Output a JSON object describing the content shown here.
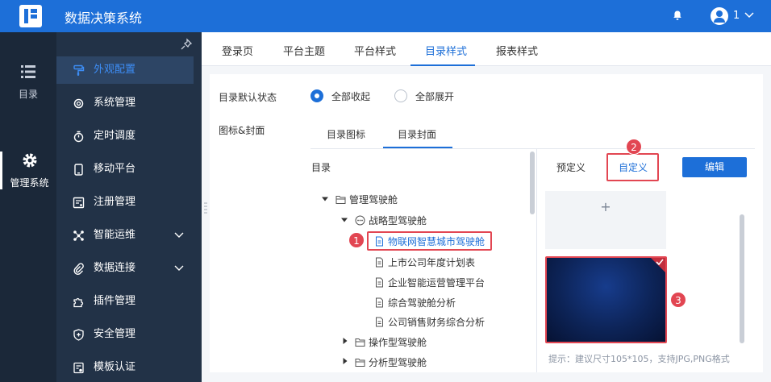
{
  "header": {
    "title": "数据决策系统",
    "user_name": "1"
  },
  "rail": {
    "items": [
      {
        "label": "目录",
        "icon": "list-icon"
      },
      {
        "label": "管理系统",
        "icon": "gear-icon"
      }
    ]
  },
  "sidebar": {
    "items": [
      {
        "label": "外观配置",
        "icon": "brush-icon",
        "active": true
      },
      {
        "label": "系统管理",
        "icon": "gear-icon"
      },
      {
        "label": "定时调度",
        "icon": "timer-icon"
      },
      {
        "label": "移动平台",
        "icon": "mobile-icon"
      },
      {
        "label": "注册管理",
        "icon": "register-icon"
      },
      {
        "label": "智能运维",
        "icon": "ops-icon",
        "expandable": true
      },
      {
        "label": "数据连接",
        "icon": "link-icon",
        "expandable": true
      },
      {
        "label": "插件管理",
        "icon": "puzzle-icon"
      },
      {
        "label": "安全管理",
        "icon": "shield-icon"
      },
      {
        "label": "模板认证",
        "icon": "certificate-icon"
      }
    ]
  },
  "tabs": [
    "登录页",
    "平台主题",
    "平台样式",
    "目录样式",
    "报表样式"
  ],
  "active_tab": "目录样式",
  "settings": {
    "default_state_label": "目录默认状态",
    "option_collapse": "全部收起",
    "option_expand": "全部展开",
    "icon_cover_label": "图标&封面"
  },
  "subtabs": [
    "目录图标",
    "目录封面"
  ],
  "tree": {
    "header": "目录",
    "nodes": [
      {
        "label": "管理驾驶舱",
        "type": "folder",
        "level": 0
      },
      {
        "label": "战略型驾驶舱",
        "type": "folder-open",
        "level": 1
      },
      {
        "label": "物联网智慧城市驾驶舱",
        "type": "file",
        "level": 2,
        "selected": true
      },
      {
        "label": "上市公司年度计划表",
        "type": "file",
        "level": 2
      },
      {
        "label": "企业智能运营管理平台",
        "type": "file",
        "level": 2
      },
      {
        "label": "综合驾驶舱分析",
        "type": "file",
        "level": 2
      },
      {
        "label": "公司销售财务综合分析",
        "type": "file",
        "level": 2
      },
      {
        "label": "操作型驾驶舱",
        "type": "folder",
        "level": 1
      },
      {
        "label": "分析型驾驶舱",
        "type": "folder",
        "level": 1
      }
    ]
  },
  "right_panel": {
    "tab_predefined": "预定义",
    "tab_custom": "自定义",
    "edit_button": "编辑",
    "add_symbol": "+",
    "hint": "提示：建议尺寸105*105，支持JPG,PNG格式"
  },
  "badges": [
    "1",
    "2",
    "3"
  ],
  "colors": {
    "primary": "#1d6fd8",
    "sidebar": "#223247",
    "rail": "#1b2839",
    "highlight": "#e24652"
  }
}
